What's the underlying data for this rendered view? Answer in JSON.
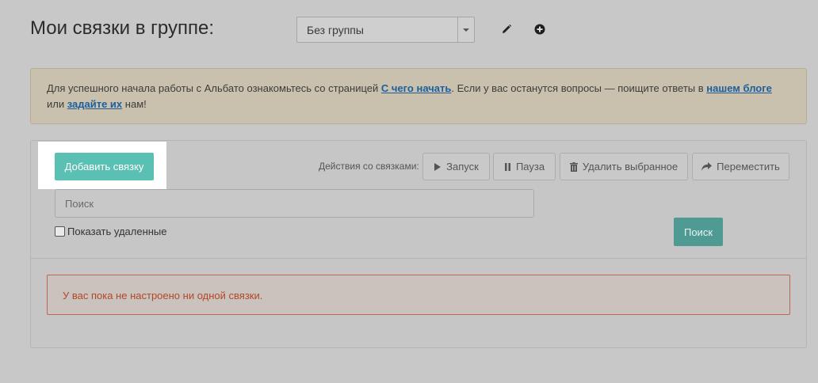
{
  "header": {
    "title": "Мои связки в группе:",
    "group_select": "Без группы",
    "edit_icon": "pencil-icon",
    "add_icon": "plus-circle-icon"
  },
  "info": {
    "text1": "Для успешного начала работы с Альбато ознакомьтесь со страницей ",
    "link1": "С чего начать",
    "text2": ". Если у вас останутся вопросы — поищите ответы в ",
    "link2": "нашем блоге",
    "text3": "или ",
    "link3": "задайте их",
    "text4": " нам!"
  },
  "toolbar": {
    "add_button": "Добавить связку",
    "actions_label": "Действия со связками:",
    "start": "Запуск",
    "pause": "Пауза",
    "delete": "Удалить выбранное",
    "move": "Переместить"
  },
  "search": {
    "placeholder": "Поиск",
    "show_deleted": "Показать удаленные",
    "button": "Поиск"
  },
  "empty_message": "У вас пока не настроено ни одной связки.",
  "colors": {
    "accent": "#5bc0b4",
    "search_button": "#4f9b93",
    "link": "#1d5f9c",
    "error_text": "#b3472a"
  }
}
